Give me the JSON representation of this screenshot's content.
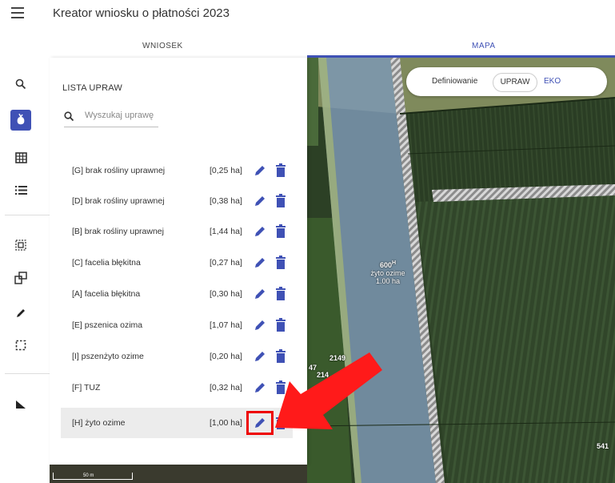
{
  "header": {
    "title": "Kreator wniosku o płatności 2023",
    "menu_icon": "hamburger-menu-icon"
  },
  "tabs": [
    {
      "label": "WNIOSEK",
      "active": false
    },
    {
      "label": "MAPA",
      "active": true
    }
  ],
  "colors": {
    "accent": "#3f51b5",
    "highlight": "#e00000",
    "arrow": "#ff0000"
  },
  "toolbar": {
    "icons": [
      "search-icon",
      "crop-icon",
      "table-icon",
      "list-icon",
      "select-area-icon",
      "copy-shapes-icon",
      "pencil-icon",
      "dashed-rectangle-icon",
      "measure-icon"
    ]
  },
  "panel": {
    "title": "LISTA UPRAW",
    "search_placeholder": "Wyszukaj uprawę",
    "crops": [
      {
        "name": "[G] brak rośliny uprawnej",
        "area": "[0,25 ha]"
      },
      {
        "name": "[D] brak rośliny uprawnej",
        "area": "[0,38 ha]"
      },
      {
        "name": "[B] brak rośliny uprawnej",
        "area": "[1,44 ha]"
      },
      {
        "name": "[C] facelia błękitna",
        "area": "[0,27 ha]"
      },
      {
        "name": "[A] facelia błękitna",
        "area": "[0,30 ha]"
      },
      {
        "name": "[E] pszenica ozima",
        "area": "[1,07 ha]"
      },
      {
        "name": "[I] pszenżyto ozime",
        "area": "[0,20 ha]"
      },
      {
        "name": "[F] TUZ",
        "area": "[0,32 ha]"
      },
      {
        "name": "[H] żyto ozime",
        "area": "[1,00 ha]",
        "selected": true
      }
    ]
  },
  "map": {
    "definition": {
      "label": "Definiowanie",
      "toggle": "UPRAW",
      "eko": "EKO"
    },
    "parcel": {
      "id": "600",
      "sup": "H",
      "crop": "żyto ozime",
      "area": "1.00 ha"
    },
    "labels": [
      "2149",
      "47",
      "214",
      "541"
    ],
    "scale": "50 m"
  }
}
